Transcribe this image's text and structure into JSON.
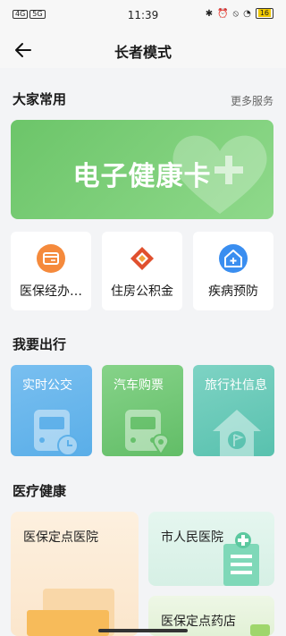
{
  "status": {
    "left_badges": [
      "4G",
      "5G"
    ],
    "time": "11:39",
    "battery": "16"
  },
  "nav": {
    "title": "长者模式"
  },
  "common": {
    "title": "大家常用",
    "more": "更多服务",
    "health_card": "电子健康卡",
    "tiles": [
      {
        "label": "医保经办…",
        "icon": "medical-insurance-card-icon"
      },
      {
        "label": "住房公积金",
        "icon": "housing-fund-icon"
      },
      {
        "label": "疾病预防",
        "icon": "disease-prevention-house-icon"
      }
    ]
  },
  "travel": {
    "title": "我要出行",
    "tiles": [
      {
        "label": "实时公交",
        "icon": "bus-clock-icon",
        "color": "#5aaee8"
      },
      {
        "label": "汽车购票",
        "icon": "bus-location-icon",
        "color": "#68c36b"
      },
      {
        "label": "旅行社信息",
        "icon": "house-flag-icon",
        "color": "#5ec8b7"
      }
    ]
  },
  "medical": {
    "title": "医疗健康",
    "tiles": [
      {
        "label": "医保定点医院"
      },
      {
        "label": "市人民医院"
      },
      {
        "label": "医保定点药店"
      }
    ]
  }
}
